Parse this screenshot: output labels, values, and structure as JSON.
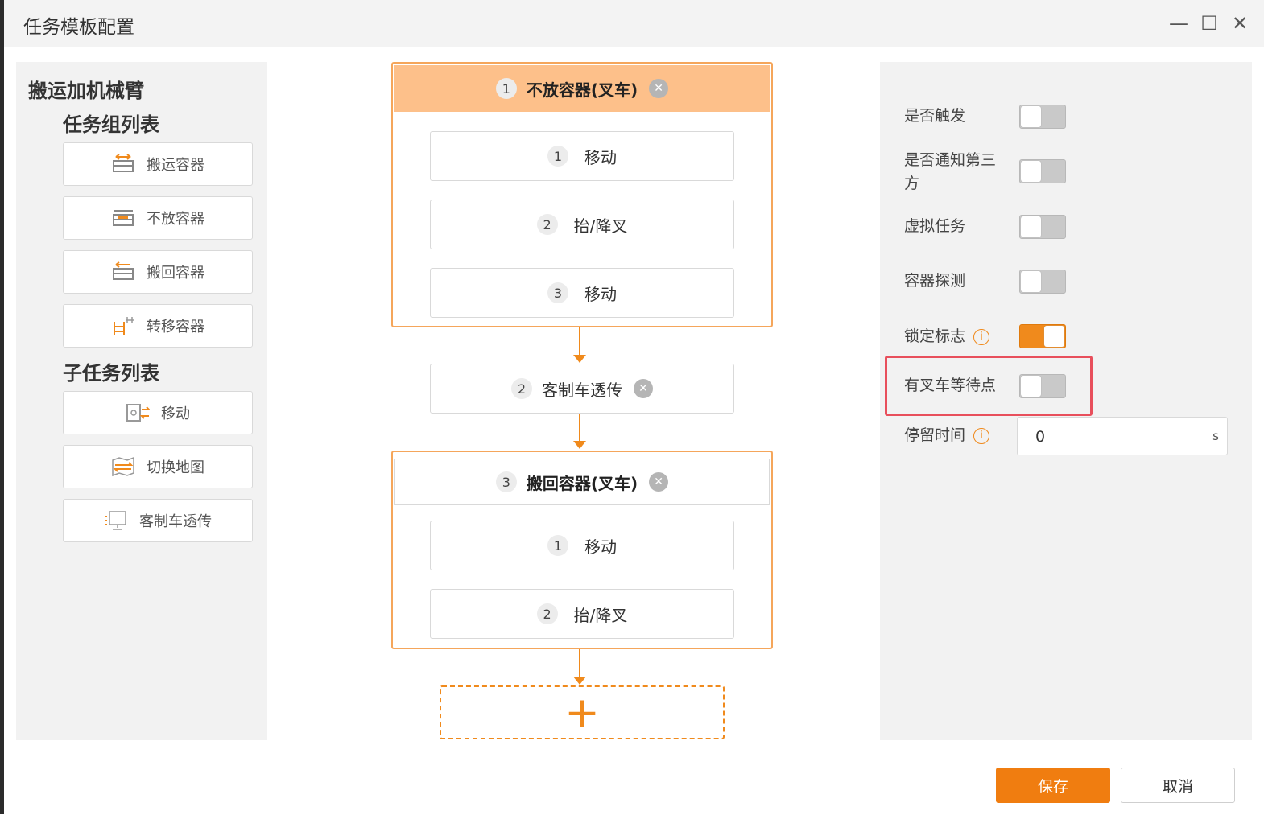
{
  "window": {
    "title": "任务模板配置",
    "minimize": "—",
    "maximize": "☐",
    "close": "✕"
  },
  "left_panel": {
    "title": "搬运加机械臂",
    "group_list_title": "任务组列表",
    "group_items": [
      {
        "label": "搬运容器",
        "icon": "carry-container-icon"
      },
      {
        "label": "不放容器",
        "icon": "no-drop-container-icon"
      },
      {
        "label": "搬回容器",
        "icon": "return-container-icon"
      },
      {
        "label": "转移容器",
        "icon": "transfer-container-icon"
      }
    ],
    "subtask_list_title": "子任务列表",
    "subtask_items": [
      {
        "label": "移动",
        "icon": "move-icon"
      },
      {
        "label": "切换地图",
        "icon": "switch-map-icon"
      },
      {
        "label": "客制车透传",
        "icon": "custom-vehicle-passthrough-icon"
      }
    ]
  },
  "flow": {
    "groups": [
      {
        "num": "1",
        "label": "不放容器(叉车)",
        "close": "✕",
        "steps": [
          {
            "num": "1",
            "label": "移动"
          },
          {
            "num": "2",
            "label": "抬/降叉"
          },
          {
            "num": "3",
            "label": "移动"
          }
        ]
      },
      {
        "num": "2",
        "label": "客制车透传",
        "close": "✕"
      },
      {
        "num": "3",
        "label": "搬回容器(叉车)",
        "close": "✕",
        "steps": [
          {
            "num": "1",
            "label": "移动"
          },
          {
            "num": "2",
            "label": "抬/降叉"
          }
        ]
      }
    ],
    "add_symbol": "+"
  },
  "properties": {
    "trigger": {
      "label": "是否触发",
      "on": false
    },
    "notify_third_party": {
      "label_line1": "是否通知第三",
      "label_line2": "方",
      "on": false
    },
    "virtual_task": {
      "label": "虚拟任务",
      "on": false
    },
    "container_detect": {
      "label": "容器探测",
      "on": false
    },
    "lock_flag": {
      "label": "锁定标志",
      "on": true,
      "info": "i"
    },
    "forklift_wait_point": {
      "label": "有叉车等待点",
      "on": false
    },
    "stay_time": {
      "label": "停留时间",
      "value": "0",
      "unit": "s",
      "info": "i"
    }
  },
  "footer": {
    "save": "保存",
    "cancel": "取消"
  },
  "colors": {
    "accent": "#f07d10",
    "active_group": "#fdc08a",
    "group_border": "#f5a65b",
    "highlight": "#e84f5c"
  }
}
